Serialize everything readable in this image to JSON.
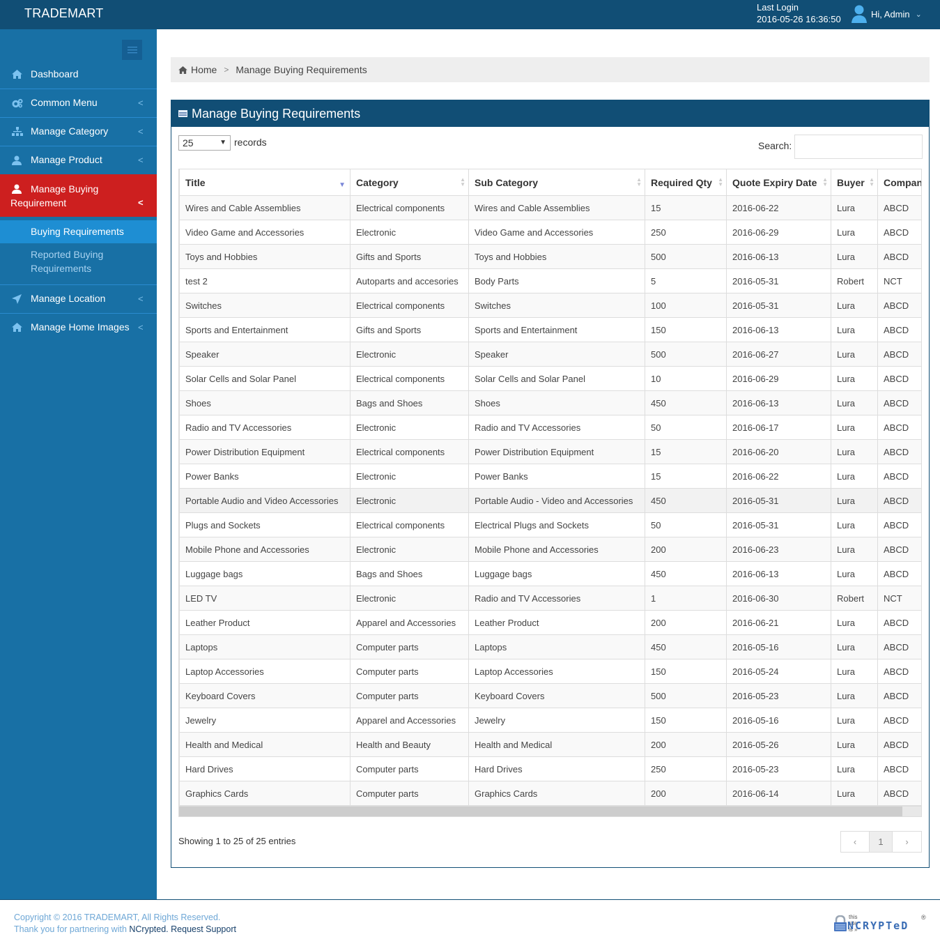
{
  "header": {
    "brand": "TRADEMART",
    "last_login_label": "Last Login",
    "last_login_value": "2016-05-26 16:36:50",
    "user_greeting": "Hi, Admin"
  },
  "sidebar": {
    "items": [
      {
        "label": "Dashboard",
        "icon": "home-icon"
      },
      {
        "label": "Common Menu",
        "icon": "cogs-icon"
      },
      {
        "label": "Manage Category",
        "icon": "sitemap-icon"
      },
      {
        "label": "Manage Product",
        "icon": "user-icon"
      },
      {
        "label": "Manage Buying",
        "label2": "Requirement",
        "icon": "user-icon"
      },
      {
        "label": "Manage Location",
        "icon": "location-arrow-icon"
      },
      {
        "label": "Manage Home Images",
        "icon": "home-icon"
      }
    ],
    "subitems": [
      {
        "label": "Buying Requirements"
      },
      {
        "label": "Reported Buying",
        "label2": "Requirements"
      }
    ]
  },
  "breadcrumb": {
    "home": "Home",
    "current": "Manage Buying Requirements"
  },
  "panel": {
    "title": "Manage Buying Requirements",
    "length_value": "25",
    "length_label": "records",
    "search_label": "Search:",
    "search_value": "",
    "info": "Showing 1 to 25 of 25 entries",
    "pager": {
      "prev": "‹",
      "current": "1",
      "next": "›"
    }
  },
  "table": {
    "columns": [
      "Title",
      "Category",
      "Sub Category",
      "Required Qty",
      "Quote Expiry Date",
      "Buyer",
      "Company"
    ],
    "rows": [
      [
        "Wires and Cable Assemblies",
        "Electrical components",
        "Wires and Cable Assemblies",
        "15",
        "2016-06-22",
        "Lura",
        "ABCD"
      ],
      [
        "Video Game and Accessories",
        "Electronic",
        "Video Game and Accessories",
        "250",
        "2016-06-29",
        "Lura",
        "ABCD"
      ],
      [
        "Toys and Hobbies",
        "Gifts and Sports",
        "Toys and Hobbies",
        "500",
        "2016-06-13",
        "Lura",
        "ABCD"
      ],
      [
        "test 2",
        "Autoparts and accesories",
        "Body Parts",
        "5",
        "2016-05-31",
        "Robert",
        "NCT"
      ],
      [
        "Switches",
        "Electrical components",
        "Switches",
        "100",
        "2016-05-31",
        "Lura",
        "ABCD"
      ],
      [
        "Sports and Entertainment",
        "Gifts and Sports",
        "Sports and Entertainment",
        "150",
        "2016-06-13",
        "Lura",
        "ABCD"
      ],
      [
        "Speaker",
        "Electronic",
        "Speaker",
        "500",
        "2016-06-27",
        "Lura",
        "ABCD"
      ],
      [
        "Solar Cells and Solar Panel",
        "Electrical components",
        "Solar Cells and Solar Panel",
        "10",
        "2016-06-29",
        "Lura",
        "ABCD"
      ],
      [
        "Shoes",
        "Bags and Shoes",
        "Shoes",
        "450",
        "2016-06-13",
        "Lura",
        "ABCD"
      ],
      [
        "Radio and TV Accessories",
        "Electronic",
        "Radio and TV Accessories",
        "50",
        "2016-06-17",
        "Lura",
        "ABCD"
      ],
      [
        "Power Distribution Equipment",
        "Electrical components",
        "Power Distribution Equipment",
        "15",
        "2016-06-20",
        "Lura",
        "ABCD"
      ],
      [
        "Power Banks",
        "Electronic",
        "Power Banks",
        "15",
        "2016-06-22",
        "Lura",
        "ABCD"
      ],
      [
        "Portable Audio and Video Accessories",
        "Electronic",
        "Portable Audio - Video and Accessories",
        "450",
        "2016-05-31",
        "Lura",
        "ABCD"
      ],
      [
        "Plugs and Sockets",
        "Electrical components",
        "Electrical Plugs and Sockets",
        "50",
        "2016-05-31",
        "Lura",
        "ABCD"
      ],
      [
        "Mobile Phone and Accessories",
        "Electronic",
        "Mobile Phone and Accessories",
        "200",
        "2016-06-23",
        "Lura",
        "ABCD"
      ],
      [
        "Luggage bags",
        "Bags and Shoes",
        "Luggage bags",
        "450",
        "2016-06-13",
        "Lura",
        "ABCD"
      ],
      [
        "LED TV",
        "Electronic",
        "Radio and TV Accessories",
        "1",
        "2016-06-30",
        "Robert",
        "NCT"
      ],
      [
        "Leather Product",
        "Apparel and Accessories",
        "Leather Product",
        "200",
        "2016-06-21",
        "Lura",
        "ABCD"
      ],
      [
        "Laptops",
        "Computer parts",
        "Laptops",
        "450",
        "2016-05-16",
        "Lura",
        "ABCD"
      ],
      [
        "Laptop Accessories",
        "Computer parts",
        "Laptop Accessories",
        "150",
        "2016-05-24",
        "Lura",
        "ABCD"
      ],
      [
        "Keyboard Covers",
        "Computer parts",
        "Keyboard Covers",
        "500",
        "2016-05-23",
        "Lura",
        "ABCD"
      ],
      [
        "Jewelry",
        "Apparel and Accessories",
        "Jewelry",
        "150",
        "2016-05-16",
        "Lura",
        "ABCD"
      ],
      [
        "Health and Medical",
        "Health and Beauty",
        "Health and Medical",
        "200",
        "2016-05-26",
        "Lura",
        "ABCD"
      ],
      [
        "Hard Drives",
        "Computer parts",
        "Hard Drives",
        "250",
        "2016-05-23",
        "Lura",
        "ABCD"
      ],
      [
        "Graphics Cards",
        "Computer parts",
        "Graphics Cards",
        "200",
        "2016-06-14",
        "Lura",
        "ABCD"
      ]
    ]
  },
  "footer": {
    "copyright": "Copyright © 2016 TRADEMART, All Rights Reserved.",
    "thanks_prefix": "Thank you for partnering with ",
    "ncrypted": "NCrypted.",
    "support": "Request Support",
    "logo_small": "this site is »",
    "logo_big": "NCRYPTeD",
    "logo_reg": "®"
  },
  "colors": {
    "topbar": "#114e75",
    "sidebar": "#1870a5",
    "active": "#cd1f1f",
    "sub_active": "#1e8ed3"
  }
}
